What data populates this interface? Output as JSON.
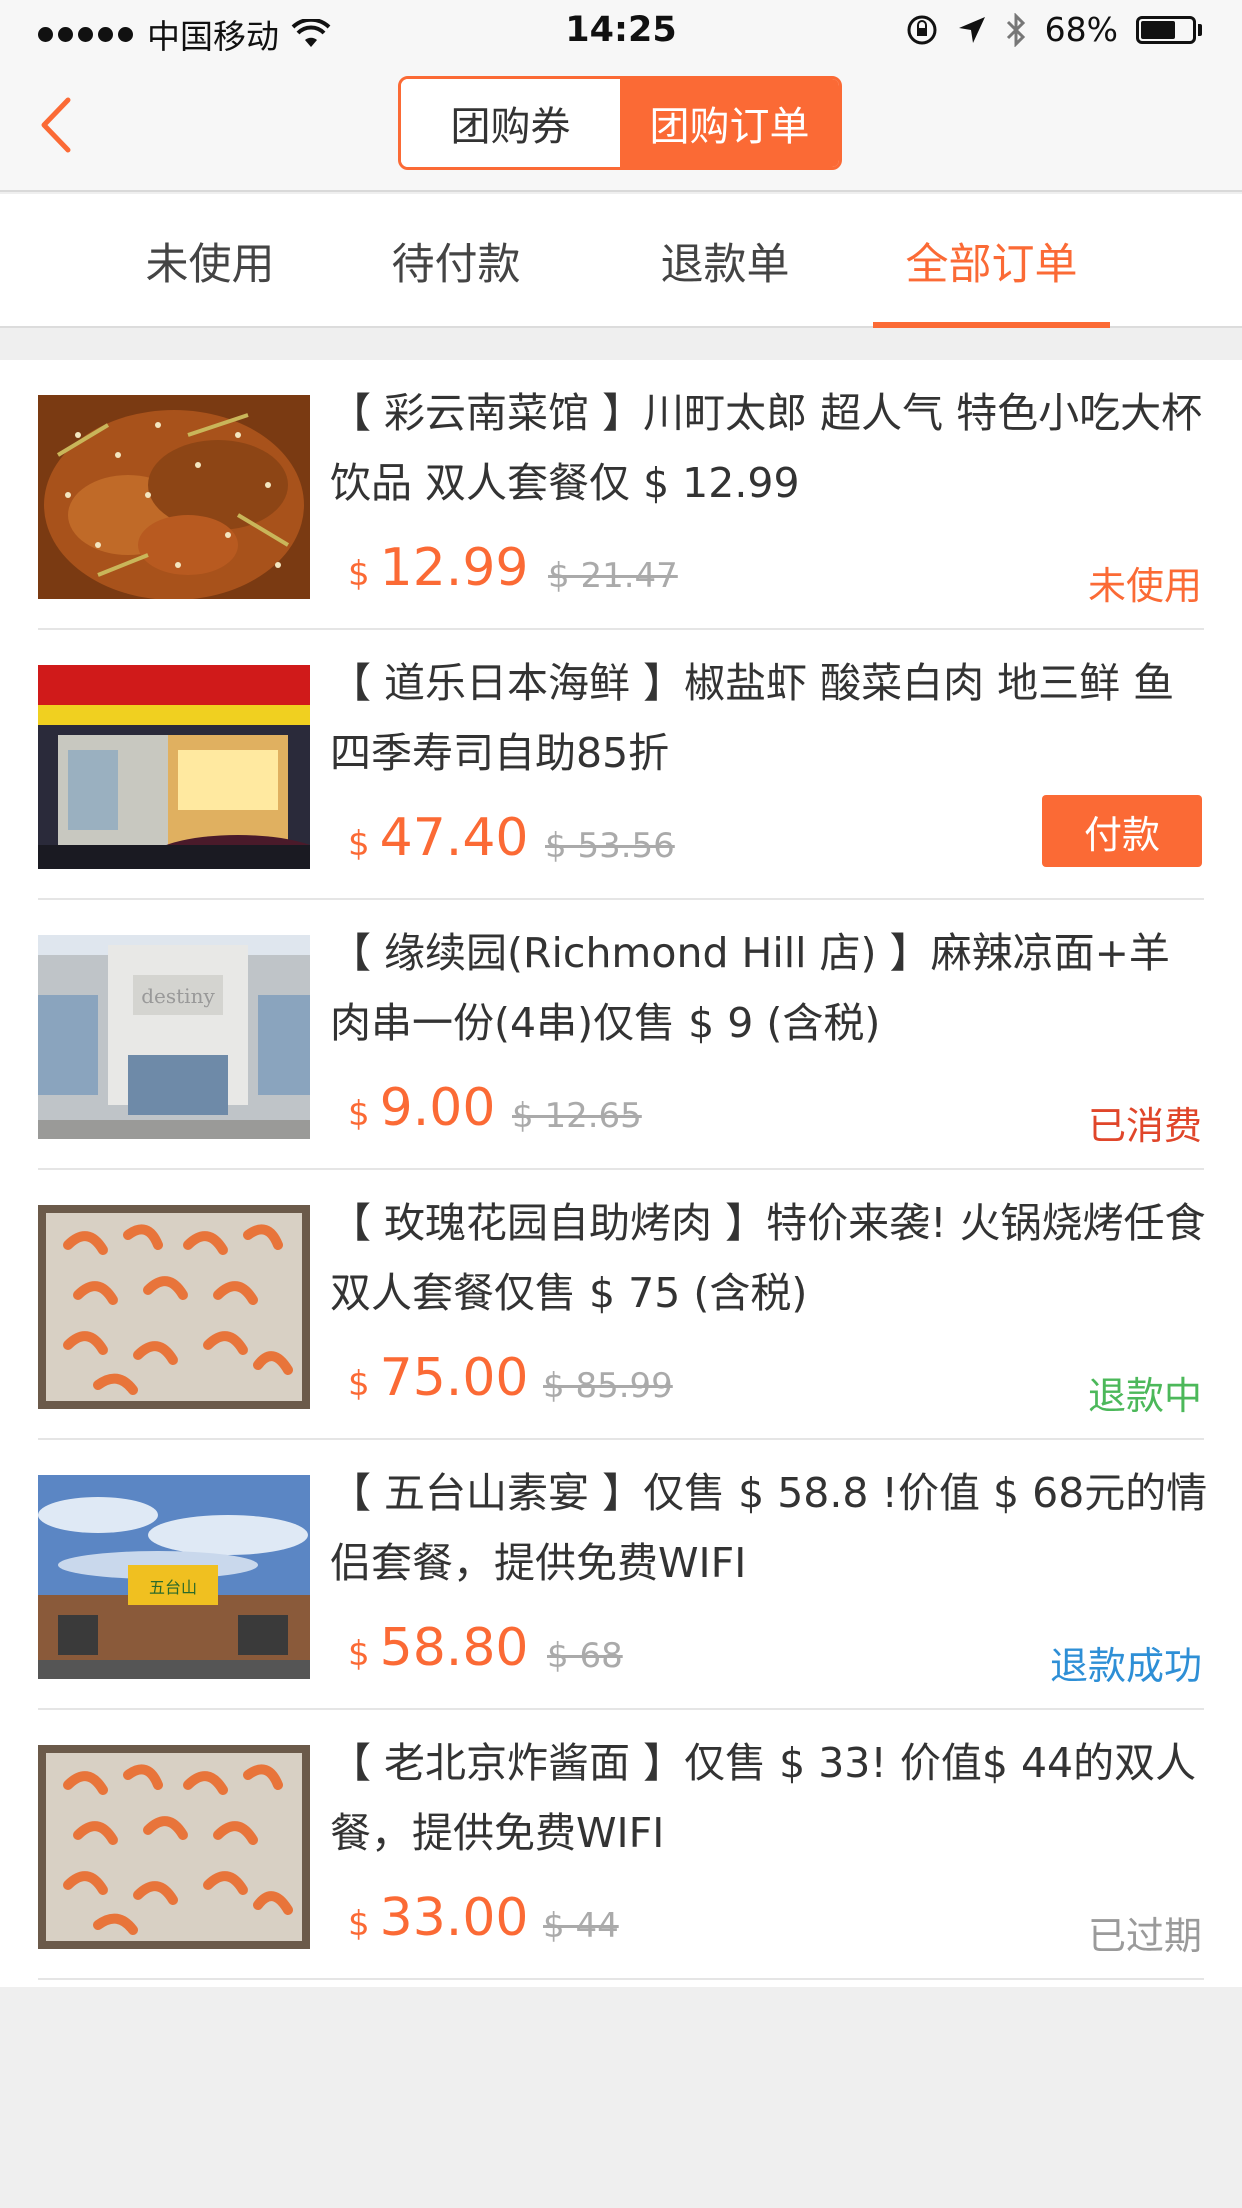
{
  "status_bar": {
    "carrier": "中国移动",
    "time": "14:25",
    "battery": "68%"
  },
  "nav": {
    "segments": [
      "团购券",
      "团购订单"
    ],
    "active_segment": 1
  },
  "tabs": [
    "未使用",
    "待付款",
    "退款单",
    "全部订单"
  ],
  "active_tab": 3,
  "currency_symbol": "$",
  "orders": [
    {
      "title": "【 彩云南菜馆 】川町太郎 超人气 特色小吃大杯饮品  双人套餐仅 $ 12.99",
      "price": "12.99",
      "original": "$ 21.47",
      "status": "未使用",
      "image": "food-dish-image"
    },
    {
      "title": "【 道乐日本海鲜 】椒盐虾  酸菜白肉  地三鲜  鱼四季寿司自助85折",
      "price": "47.40",
      "original": "$ 53.56",
      "action": "付款",
      "image": "restaurant-storefront-image"
    },
    {
      "title": "【 缘续园(Richmond Hill 店) 】麻辣凉面+羊肉串一份(4串)仅售 $ 9 (含税)",
      "price": "9.00",
      "original": "$ 12.65",
      "status": "已消费",
      "image": "building-exterior-image"
    },
    {
      "title": "【 玫瑰花园自助烤肉 】特价来袭! 火锅烧烤任食双人套餐仅售 $ 75 (含税)",
      "price": "75.00",
      "original": "$ 85.99",
      "status": "退款中",
      "image": "shrimp-tray-image"
    },
    {
      "title": "【 五台山素宴 】仅售 $ 58.8 !价值 $ 68元的情侣套餐，提供免费WIFI",
      "price": "58.80",
      "original": "$ 68",
      "status": "退款成功",
      "image": "restaurant-exterior-image"
    },
    {
      "title": "【 老北京炸酱面 】仅售 $ 33! 价值$ 44的双人餐，提供免费WIFI",
      "price": "33.00",
      "original": "$ 44",
      "status": "已过期",
      "image": "shrimp-tray-image"
    }
  ]
}
